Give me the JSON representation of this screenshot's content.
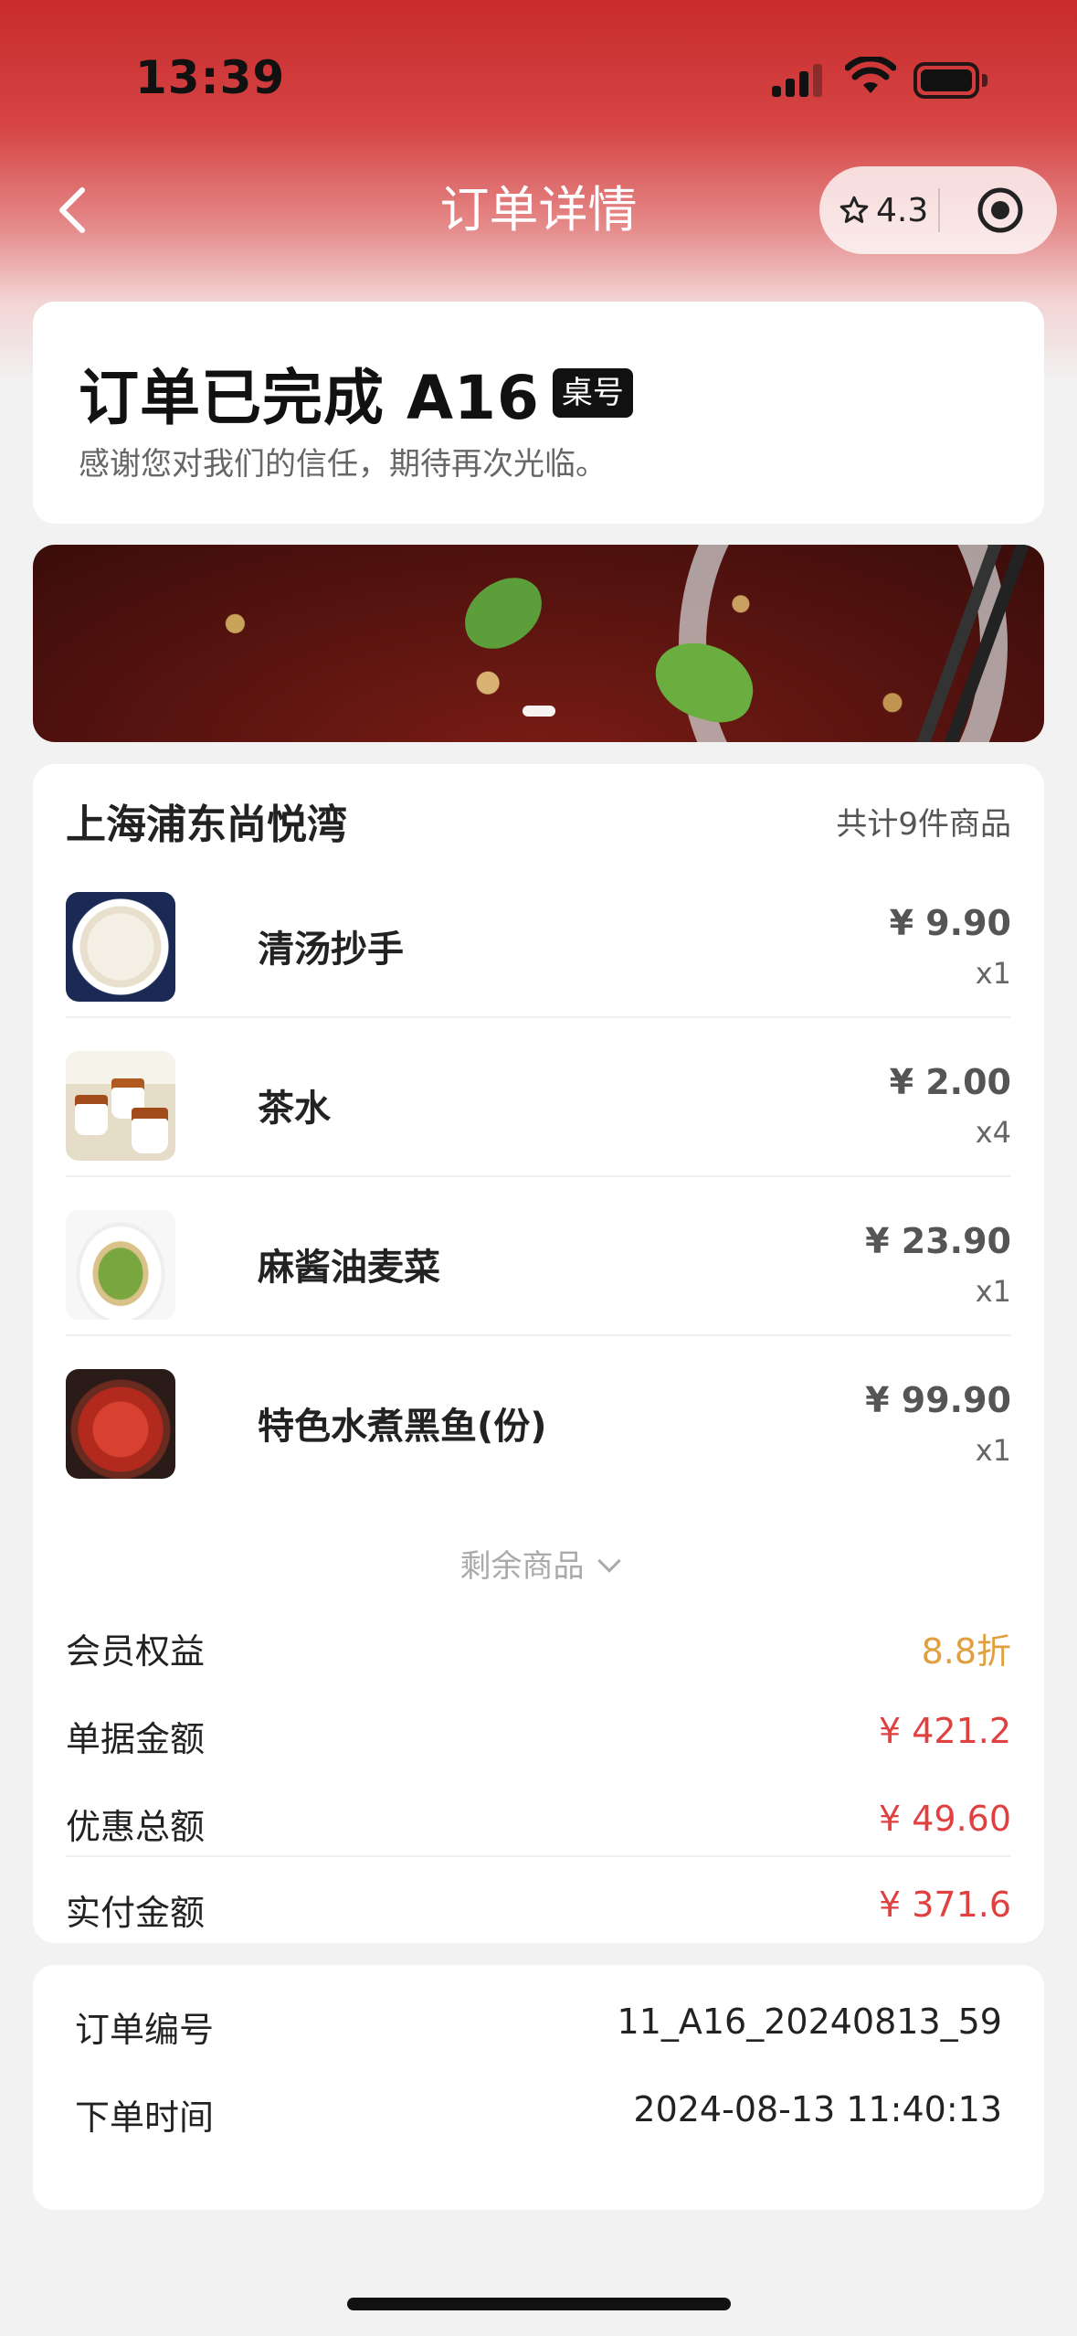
{
  "status_bar": {
    "time": "13:39"
  },
  "nav": {
    "title": "订单详情",
    "rating": "4.3"
  },
  "status": {
    "title": "订单已完成 A16",
    "table_badge": "桌号",
    "subtitle": "感谢您对我们的信任，期待再次光临。"
  },
  "order": {
    "shop_name": "上海浦东尚悦湾",
    "item_count": "共计9件商品",
    "items": [
      {
        "name": "清汤抄手",
        "price": "¥ 9.90",
        "qty": "x1"
      },
      {
        "name": "茶水",
        "price": "¥ 2.00",
        "qty": "x4"
      },
      {
        "name": "麻酱油麦菜",
        "price": "¥ 23.90",
        "qty": "x1"
      },
      {
        "name": "特色水煮黑鱼(份)",
        "price": "¥ 99.90",
        "qty": "x1"
      }
    ],
    "more_label": "剩余商品",
    "summary": [
      {
        "label": "会员权益",
        "value": "8.8折",
        "color": "#e0a040"
      },
      {
        "label": "单据金额",
        "value": "¥ 421.2",
        "color": "#e04040"
      },
      {
        "label": "优惠总额",
        "value": "¥ 49.60",
        "color": "#e04040"
      },
      {
        "label": "实付金额",
        "value": "¥ 371.6",
        "color": "#e04040"
      }
    ]
  },
  "info": {
    "order_no_label": "订单编号",
    "order_no": "11_A16_20240813_59",
    "time_label": "下单时间",
    "time": "2024-08-13 11:40:13"
  },
  "colors": {
    "brand_red": "#c82b2b",
    "price_red": "#e04040",
    "discount_orange": "#e0a040"
  }
}
